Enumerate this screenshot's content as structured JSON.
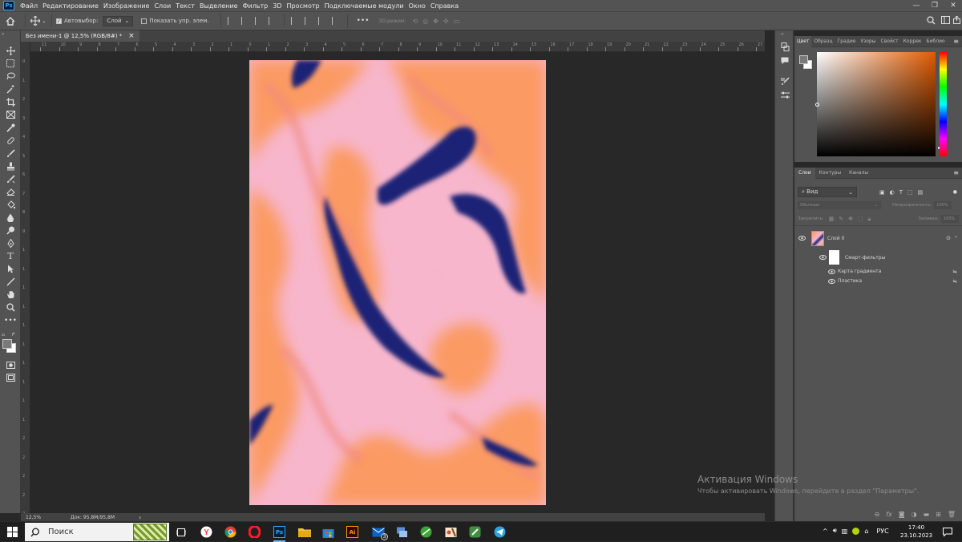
{
  "app": {
    "logo": "Ps"
  },
  "menu": [
    "Файл",
    "Редактирование",
    "Изображение",
    "Слои",
    "Текст",
    "Выделение",
    "Фильтр",
    "3D",
    "Просмотр",
    "Подключаемые модули",
    "Окно",
    "Справка"
  ],
  "window_controls": {
    "minimize": "—",
    "maximize": "❐",
    "close": "✕"
  },
  "options": {
    "autoselect_label": "Автовыбор:",
    "autoselect_value": "Слой",
    "show_transform_label": "Показать упр. элем.",
    "mode_3d_label": "3D-режим:",
    "more": "•••"
  },
  "document_tab": {
    "title": "Без имени-1 @ 12,5% (RGB/8#) *",
    "close": "×"
  },
  "ruler_top_ticks": [
    "11",
    "10",
    "9",
    "8",
    "7",
    "6",
    "5",
    "4",
    "3",
    "2",
    "1",
    "0",
    "1",
    "2",
    "3",
    "4",
    "5",
    "6",
    "7",
    "8",
    "9",
    "10",
    "11",
    "12",
    "13",
    "14",
    "15",
    "16",
    "17",
    "18",
    "19",
    "20",
    "21",
    "22",
    "23",
    "24",
    "25",
    "26",
    "27"
  ],
  "ruler_left_ticks": [
    "0",
    "1",
    "2",
    "3",
    "4",
    "5",
    "6",
    "7",
    "8",
    "9",
    "1",
    "1",
    "1",
    "1",
    "1",
    "1",
    "1",
    "1",
    "1",
    "1",
    "2",
    "2",
    "2",
    "2",
    "2",
    "2"
  ],
  "status": {
    "zoom": "12,5%",
    "doc": "Док: 95,8M/95,8M",
    "arrow": "›"
  },
  "color_panel": {
    "tabs": [
      "Цвет",
      "Образц",
      "Градие",
      "Узоры",
      "Свойст",
      "Коррек",
      "Библио"
    ],
    "fg_color": "#7a7a7a",
    "bg_color": "#ffffff"
  },
  "layers_panel": {
    "tabs": [
      "Слои",
      "Контуры",
      "Каналы"
    ],
    "filter_kind": "Вид",
    "blend_mode": "Обычные",
    "opacity_label": "Непрозрачность:",
    "opacity_value": "100%",
    "lock_label": "Закрепить:",
    "fill_label": "Заливка:",
    "fill_value": "100%",
    "layers": [
      {
        "name": "Слой 0"
      }
    ],
    "smart_filters_label": "Смарт-фильтры",
    "filters": [
      "Карта градиента",
      "Пластика"
    ]
  },
  "watermark": {
    "title": "Активация Windows",
    "subtitle": "Чтобы активировать Windows, перейдите в раздел \"Параметры\"."
  },
  "taskbar": {
    "search_placeholder": "Поиск",
    "tray_lang": "РУС",
    "time": "17:40",
    "date": "23.10.2023",
    "badge_mail": "3"
  },
  "colors": {
    "artwork_orange": "#fb9a62",
    "artwork_pink": "#f7b6cc",
    "artwork_navy": "#1d2476"
  }
}
